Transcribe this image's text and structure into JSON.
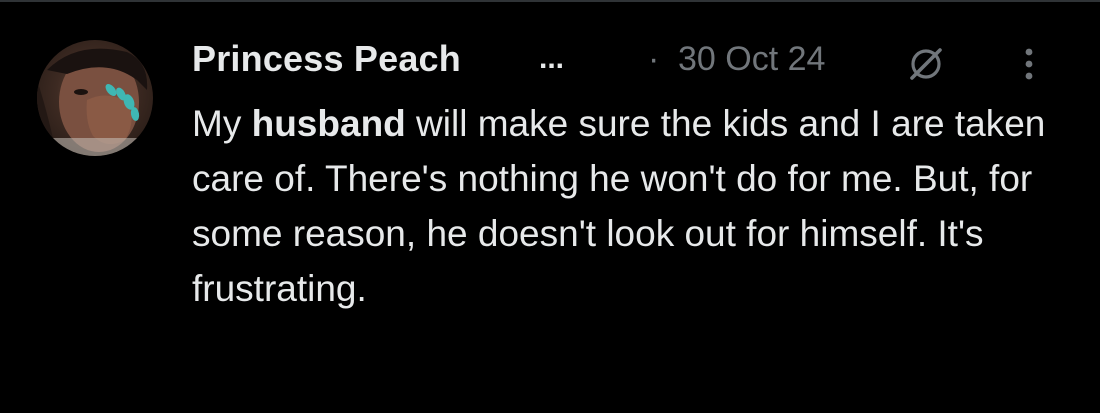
{
  "post": {
    "author": {
      "display_name": "Princess Peach",
      "truncation": "..."
    },
    "dot_separator": "·",
    "timestamp": "30 Oct 24",
    "header_icons": {
      "grok": "grok-icon",
      "more": "more-vertical-icon"
    },
    "text": {
      "part1": "My ",
      "part2_bold": "husband",
      "part3": " will make sure the kids and I are taken care of. There's nothing he won't do for me. But, for some reason, he doesn't look out for himself. It's frustrating."
    }
  },
  "colors": {
    "background": "#000000",
    "primary_text": "#e7e9ea",
    "secondary_text": "#71767b",
    "divider": "#2f3336"
  }
}
